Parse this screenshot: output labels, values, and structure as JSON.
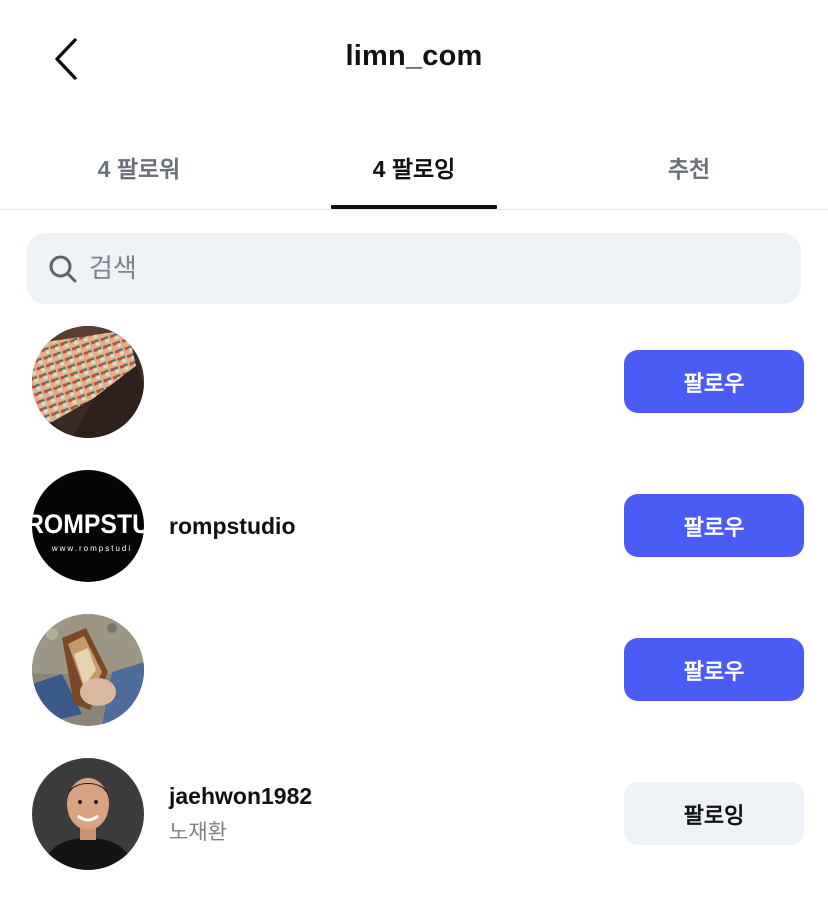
{
  "header": {
    "back_icon": "chevron-left-icon",
    "title": "limn_com"
  },
  "tabs": [
    {
      "label": "4 팔로워",
      "active": false
    },
    {
      "label": "4 팔로잉",
      "active": true
    },
    {
      "label": "추천",
      "active": false
    }
  ],
  "search": {
    "icon": "search-icon",
    "placeholder": "검색",
    "value": ""
  },
  "following_list": [
    {
      "username": "",
      "full_name": "",
      "avatar": "stained-glass-ceiling-photo",
      "button_label": "팔로우",
      "button_state": "follow"
    },
    {
      "username": "rompstudio",
      "full_name": "",
      "avatar": "rompstudio-logo",
      "avatar_text": "ROMPSTU",
      "avatar_subtext": "www.rompstudi",
      "button_label": "팔로우",
      "button_state": "follow"
    },
    {
      "username": "",
      "full_name": "",
      "avatar": "hand-holding-pastry-photo",
      "button_label": "팔로우",
      "button_state": "follow"
    },
    {
      "username": "jaehwon1982",
      "full_name": "노재환",
      "avatar": "man-portrait-photo",
      "button_label": "팔로잉",
      "button_state": "following"
    }
  ],
  "colors": {
    "accent": "#4a5cf5",
    "secondary_button_bg": "#eef1f5",
    "search_bg": "#eef1f5",
    "muted_text": "#7d828a",
    "tab_inactive": "#6b7078",
    "text": "#111111"
  }
}
